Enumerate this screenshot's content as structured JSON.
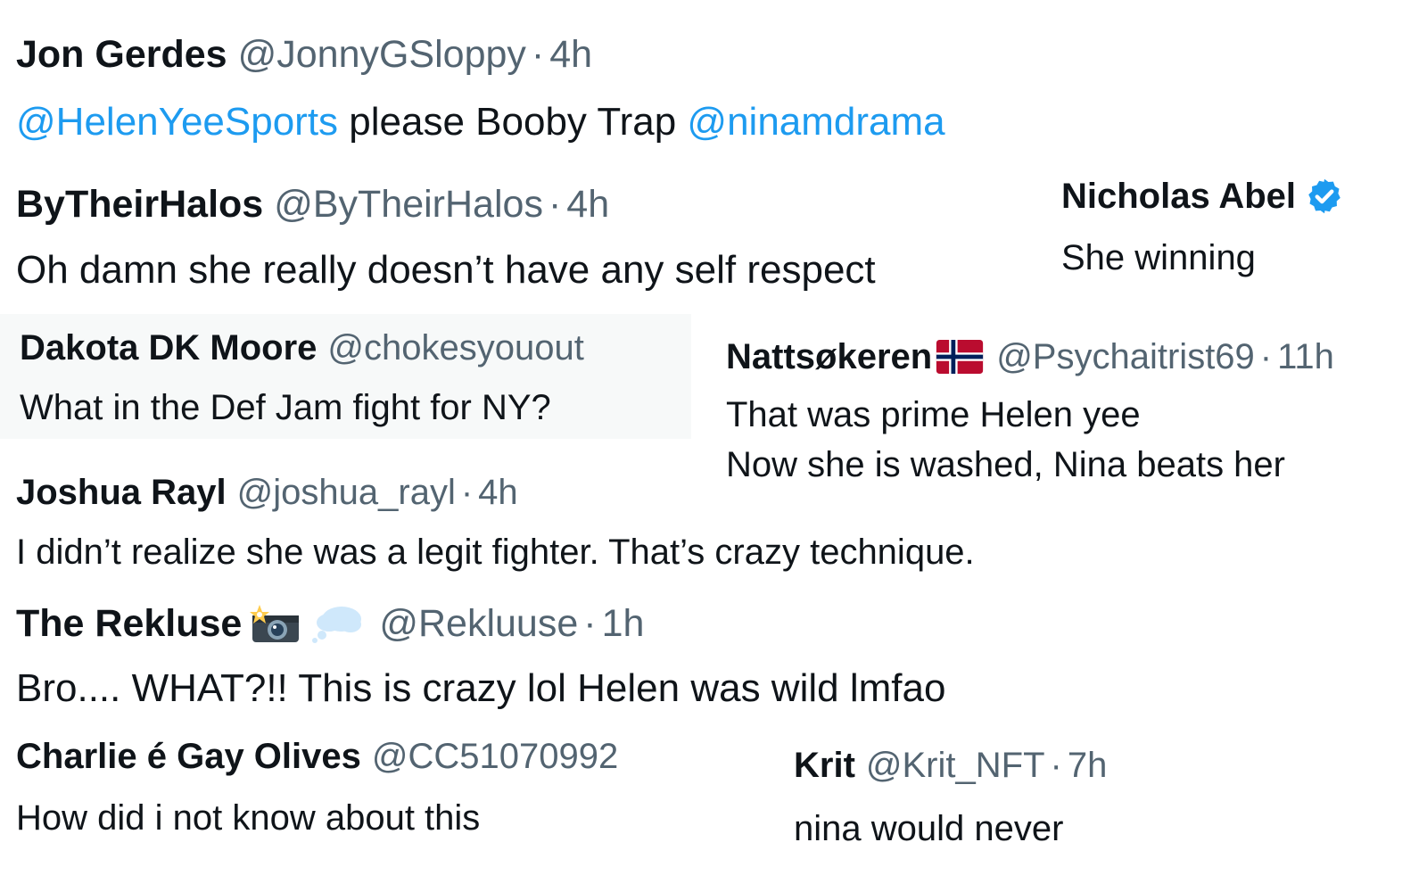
{
  "replies": [
    {
      "name": "Jon Gerdes",
      "handle": "@JonnyGSloppy",
      "sep": "·",
      "time": "4h",
      "text_parts": [
        "@HelenYeeSports",
        " please Booby Trap ",
        "@ninamdrama"
      ]
    },
    {
      "name": "ByTheirHalos",
      "handle": "@ByTheirHalos",
      "sep": "·",
      "time": "4h",
      "text": "Oh damn she really doesn’t have any self respect"
    },
    {
      "name": "Nicholas Abel",
      "verified_icon": "verified-badge-icon",
      "text": "She winning"
    },
    {
      "name": "Dakota DK Moore",
      "handle": "@chokesyouout",
      "text": "What in the Def Jam fight for NY?"
    },
    {
      "name": "Nattsøkeren",
      "flag_icon": "norway-flag-icon",
      "handle": "@Psychaitrist69",
      "sep": "·",
      "time": "11h",
      "text_line1": "That was prime Helen yee",
      "text_line2": "Now she is washed, Nina beats her"
    },
    {
      "name": "Joshua Rayl",
      "handle": "@joshua_rayl",
      "sep": "·",
      "time": "4h",
      "text": "I didn’t realize she was a legit fighter. That’s crazy technique."
    },
    {
      "name": "The Rekluse",
      "emoji_icons": [
        "camera-flash-icon",
        "thought-bubble-icon"
      ],
      "handle": "@Rekluuse",
      "sep": "·",
      "time": "1h",
      "text": "Bro.... WHAT?!! This is crazy lol Helen was wild lmfao"
    },
    {
      "name": "Charlie é Gay Olives",
      "handle": "@CC51070992",
      "text": "How did i not know about this"
    },
    {
      "name": "Krit",
      "handle": "@Krit_NFT",
      "sep": "·",
      "time": "7h",
      "text": "nina would never"
    }
  ],
  "colors": {
    "text": "#0f1419",
    "secondary": "#536471",
    "mention": "#1d9bf0",
    "verified": "#1d9bf0"
  }
}
